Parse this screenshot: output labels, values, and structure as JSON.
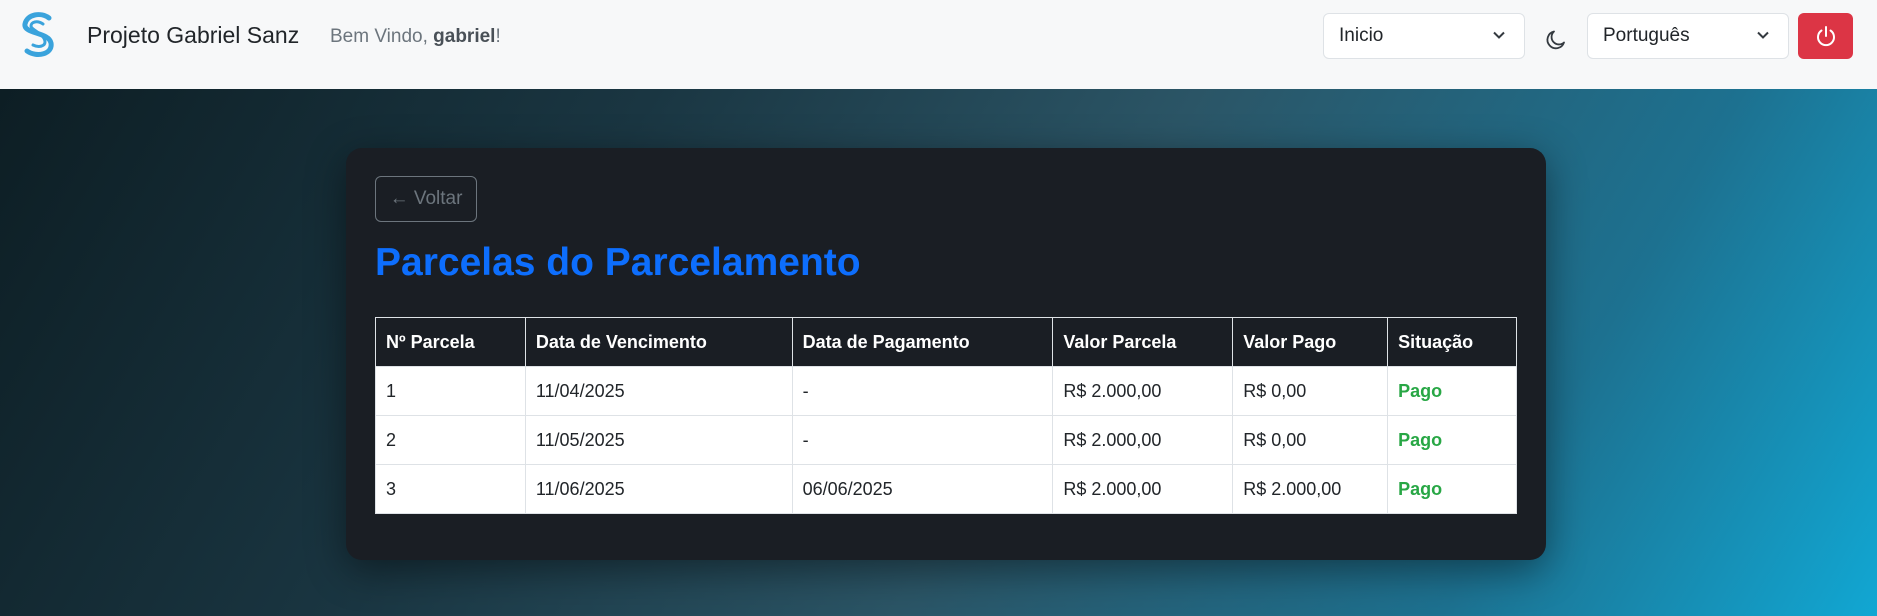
{
  "navbar": {
    "brand": "Projeto Gabriel Sanz",
    "welcome_prefix": "Bem Vindo, ",
    "user": "gabriel",
    "welcome_suffix": "!",
    "nav_select": "Inicio",
    "language_select": "Português",
    "icons": [
      "logo-icon",
      "chevron-down-icon",
      "moon-icon",
      "power-icon"
    ],
    "accent_danger": "#dc3545"
  },
  "main": {
    "back_label": "← Voltar",
    "title": "Parcelas do Parcelamento",
    "title_color": "#0d6efd",
    "status_color": "#28a745",
    "table": {
      "headers": [
        "Nº Parcela",
        "Data de Vencimento",
        "Data de Pagamento",
        "Valor Parcela",
        "Valor Pago",
        "Situação"
      ],
      "rows": [
        [
          "1",
          "11/04/2025",
          "-",
          "R$ 2.000,00",
          "R$ 0,00",
          "Pago"
        ],
        [
          "2",
          "11/05/2025",
          "-",
          "R$ 2.000,00",
          "R$ 0,00",
          "Pago"
        ],
        [
          "3",
          "11/06/2025",
          "06/06/2025",
          "R$ 2.000,00",
          "R$ 2.000,00",
          "Pago"
        ]
      ]
    }
  }
}
